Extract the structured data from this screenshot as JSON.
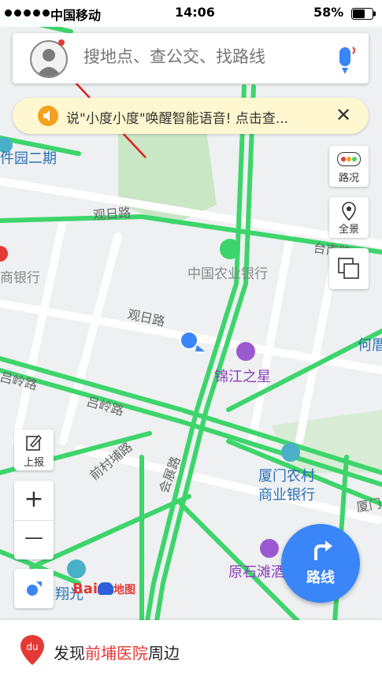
{
  "status": {
    "carrier": "中国移动",
    "time": "14:06",
    "battery": "58%"
  },
  "search": {
    "placeholder": "搜地点、查公交、找路线"
  },
  "voice_banner": {
    "text": "说\"小度小度\"唤醒智能语音! 点击查...",
    "close": "✕"
  },
  "right_controls": {
    "traffic_label": "路况",
    "panorama_label": "全景"
  },
  "left_controls": {
    "report_label": "上报",
    "zoom_in": "+",
    "zoom_out": "—"
  },
  "map_labels": {
    "software_park": "件园二期",
    "guanri_road_1": "观日路",
    "guanri_road_2": "观日路",
    "abc_bank": "中国农业银行",
    "merchants_bank": "商银行",
    "tai_nan": "台南路",
    "he_partial": "何厝",
    "jinjiang": "锦江之星",
    "lvling_1": "吕岭路",
    "lvling_2": "吕岭路",
    "qiancun": "前村埔路",
    "huizhan": "会展路",
    "xiamen_bank_1": "厦门农村",
    "xiamen_bank_2": "商业银行",
    "xiamen_partial": "厦门",
    "yuanshitan": "原石滩酒",
    "xiangguang": "翔光",
    "baidu_text": "Bai",
    "baidu_ditu": "地图"
  },
  "route_button": {
    "label": "路线"
  },
  "bottom_bar": {
    "prefix": "发现",
    "highlight": "前埔医院",
    "suffix": "周边"
  },
  "colors": {
    "road_green": "#3dd56b",
    "accent_blue": "#3a85f7",
    "banner_bg": "#fff7cf",
    "highlight_red": "#e53935"
  }
}
